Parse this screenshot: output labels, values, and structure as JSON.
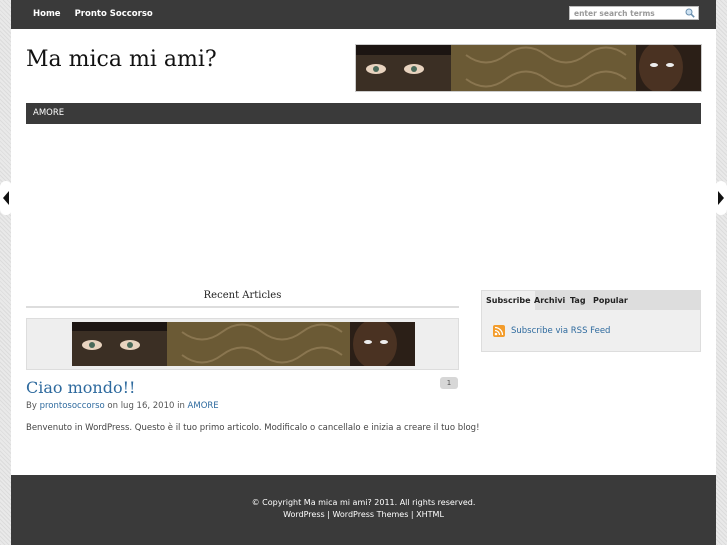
{
  "topnav": {
    "home": "Home",
    "pronto": "Pronto Soccorso"
  },
  "search": {
    "placeholder": "enter search terms"
  },
  "site": {
    "title": "Ma mica mi ami?"
  },
  "category": {
    "label": "AMORE"
  },
  "recent": {
    "heading": "Recent Articles"
  },
  "post": {
    "title": "Ciao mondo!!",
    "comments": "1",
    "by": "By",
    "author": "prontosoccorso",
    "on": " on lug 16, 2010 in ",
    "category": "AMORE",
    "excerpt": "Benvenuto in WordPress. Questo è il tuo primo articolo. Modificalo o cancellalo e inizia a creare il tuo blog!"
  },
  "sidebar": {
    "tabs": [
      "Subscribe",
      "Archivi",
      "Tag",
      "Popular"
    ],
    "rss_label": "Subscribe via RSS Feed"
  },
  "footer": {
    "copyright": "© Copyright Ma mica mi ami? 2011. All rights reserved.",
    "wordpress": "WordPress",
    "themes": "WordPress Themes",
    "xhtml": "XHTML",
    "sep": " | "
  },
  "colors": {
    "link": "#2e6a9e",
    "bar": "#3a3a3a"
  }
}
